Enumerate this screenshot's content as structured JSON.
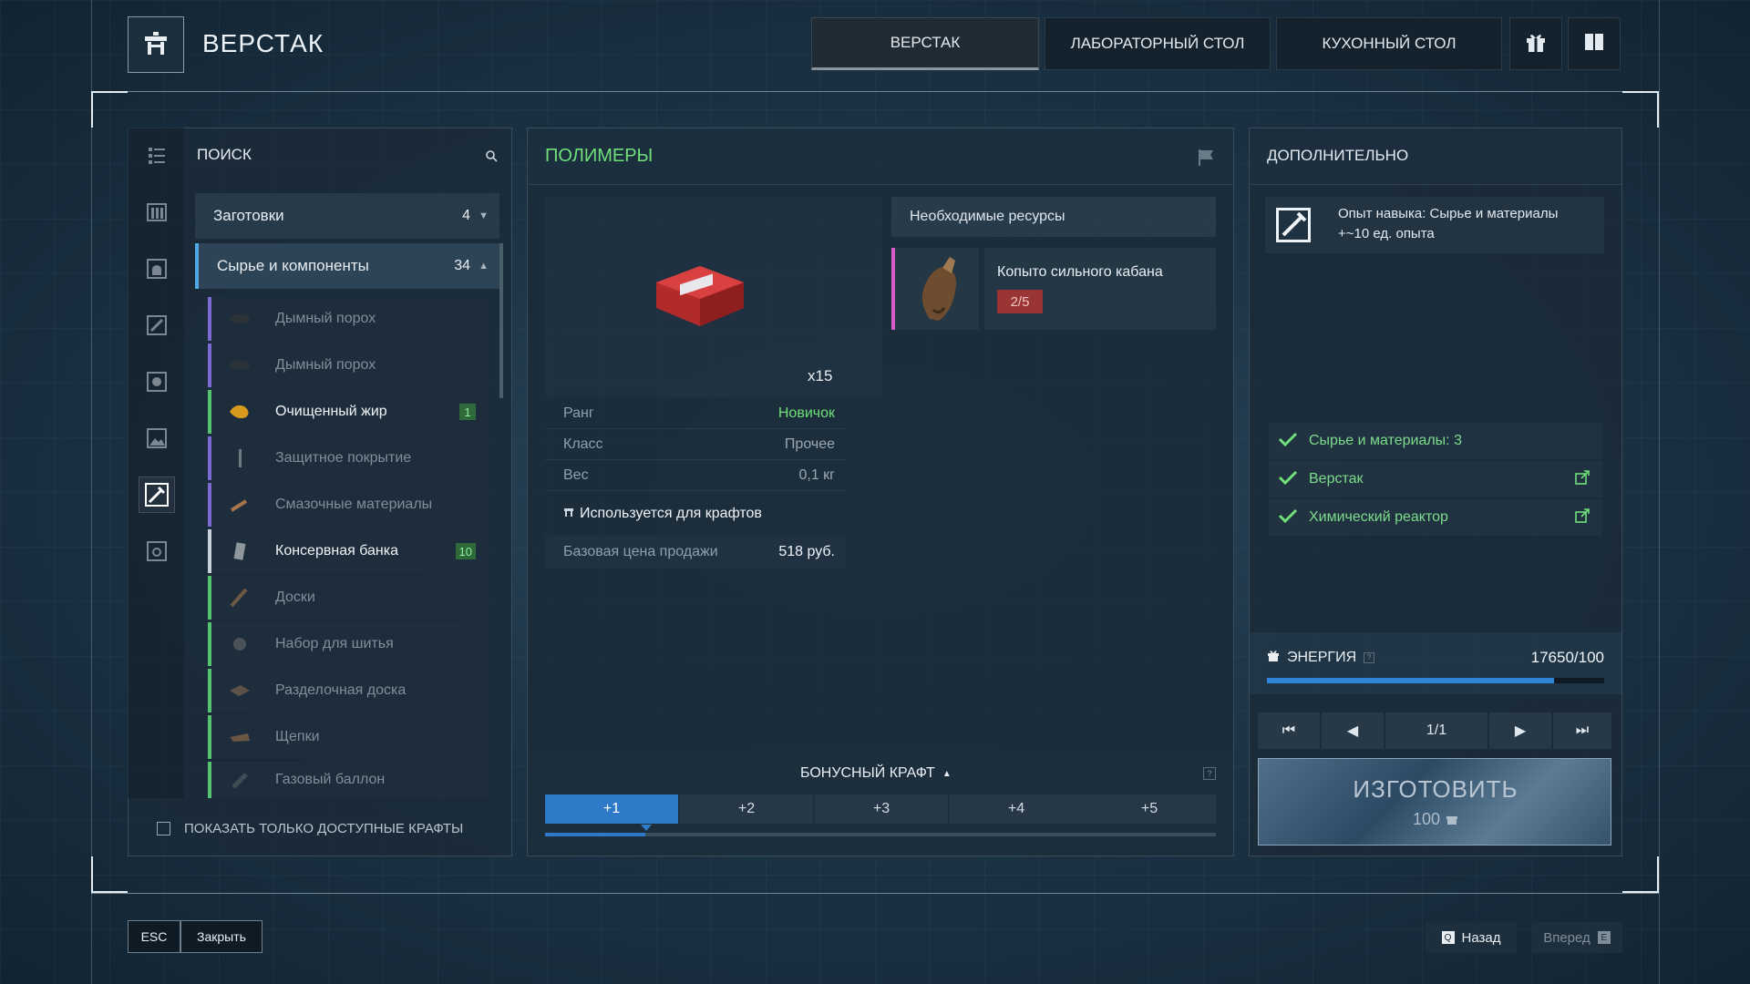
{
  "header": {
    "title": "ВЕРСТАК",
    "tabs": [
      {
        "label": "ВЕРСТАК",
        "active": true
      },
      {
        "label": "ЛАБОРАТОРНЫЙ СТОЛ",
        "active": false
      },
      {
        "label": "КУХОННЫЙ СТОЛ",
        "active": false
      }
    ],
    "icons": [
      "gift-icon",
      "book-icon"
    ]
  },
  "left_panel": {
    "search_label": "ПОИСК",
    "categories": [
      {
        "label": "Заготовки",
        "count": "4",
        "expanded": false
      },
      {
        "label": "Сырье и компоненты",
        "count": "34",
        "expanded": true
      }
    ],
    "items": [
      {
        "label": "Дымный порох",
        "qty": "",
        "available": false,
        "rarity": "purple"
      },
      {
        "label": "Дымный порох",
        "qty": "",
        "available": false,
        "rarity": "purple"
      },
      {
        "label": "Очищенный жир",
        "qty": "1",
        "available": true,
        "rarity": "green"
      },
      {
        "label": "Защитное покрытие",
        "qty": "",
        "available": false,
        "rarity": "purple"
      },
      {
        "label": "Смазочные материалы",
        "qty": "",
        "available": false,
        "rarity": "purple"
      },
      {
        "label": "Консервная банка",
        "qty": "10",
        "available": true,
        "rarity": "white"
      },
      {
        "label": "Доски",
        "qty": "",
        "available": false,
        "rarity": "green"
      },
      {
        "label": "Набор для шитья",
        "qty": "",
        "available": false,
        "rarity": "green"
      },
      {
        "label": "Разделочная доска",
        "qty": "",
        "available": false,
        "rarity": "green"
      },
      {
        "label": "Щепки",
        "qty": "",
        "available": false,
        "rarity": "green"
      },
      {
        "label": "Газовый баллон",
        "qty": "",
        "available": false,
        "rarity": "green"
      }
    ],
    "filter_label": "ПОКАЗАТЬ ТОЛЬКО ДОСТУПНЫЕ КРАФТЫ"
  },
  "center_panel": {
    "title": "ПОЛИМЕРЫ",
    "output_count": "x15",
    "stats": [
      {
        "label": "Ранг",
        "value": "Новичок"
      },
      {
        "label": "Класс",
        "value": "Прочее"
      },
      {
        "label": "Вес",
        "value": "0,1 кг"
      }
    ],
    "used_for_label": "Используется для крафтов",
    "price_label": "Базовая цена продажи",
    "price_value": "518 руб.",
    "resources_header": "Необходимые ресурсы",
    "resource": {
      "name": "Копыто сильного кабана",
      "progress": "2/5"
    },
    "bonus_craft_label": "БОНУСНЫЙ КРАФТ",
    "bonus_tabs": [
      "+1",
      "+2",
      "+3",
      "+4",
      "+5"
    ],
    "bonus_active_index": 0,
    "bonus_progress": 0.15
  },
  "right_panel": {
    "title": "ДОПОЛНИТЕЛЬНО",
    "xp_line1": "Опыт навыка: Сырье и материалы",
    "xp_line2": "+~10 ед. опыта",
    "requirements": [
      {
        "label": "Сырье и материалы: 3",
        "link": false
      },
      {
        "label": "Верстак",
        "link": true
      },
      {
        "label": "Химический реактор",
        "link": true
      }
    ],
    "energy_label": "ЭНЕРГИЯ",
    "energy_value": "17650/100",
    "energy_fill": 0.85,
    "pager": "1/1",
    "craft_label": "ИЗГОТОВИТЬ",
    "craft_cost": "100"
  },
  "footer": {
    "esc_key": "ESC",
    "close_label": "Закрыть",
    "back_key": "Q",
    "back_label": "Назад",
    "forward_label": "Вперед",
    "forward_key": "E"
  },
  "colors": {
    "accent_green": "#6fe07a",
    "accent_blue": "#2e7ac8",
    "rarity_purple": "#7b6bd1",
    "rarity_green": "#56c46e"
  }
}
